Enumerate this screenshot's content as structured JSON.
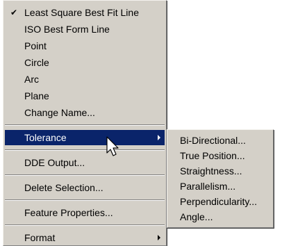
{
  "main_menu": {
    "items": [
      {
        "label": "Least Square Best Fit Line",
        "checked": true
      },
      {
        "label": "ISO Best Form Line"
      },
      {
        "label": "Point"
      },
      {
        "label": "Circle"
      },
      {
        "label": "Arc"
      },
      {
        "label": "Plane"
      },
      {
        "label": "Change Name..."
      },
      {
        "label": "Tolerance",
        "submenu": true,
        "highlighted": true
      },
      {
        "label": "DDE Output..."
      },
      {
        "label": "Delete Selection..."
      },
      {
        "label": "Feature Properties..."
      },
      {
        "label": "Format",
        "submenu": true
      }
    ]
  },
  "tolerance_submenu": {
    "items": [
      {
        "label": "Bi-Directional..."
      },
      {
        "label": "True Position..."
      },
      {
        "label": "Straightness..."
      },
      {
        "label": "Parallelism..."
      },
      {
        "label": "Perpendicularity..."
      },
      {
        "label": "Angle..."
      }
    ]
  },
  "icons": {
    "check": "checkmark-icon",
    "submenu_arrow": "submenu-arrow-icon",
    "cursor": "mouse-pointer-icon"
  },
  "colors": {
    "menu_background": "#d4d0c8",
    "highlight": "#0a246a",
    "highlight_text": "#ffffff"
  }
}
